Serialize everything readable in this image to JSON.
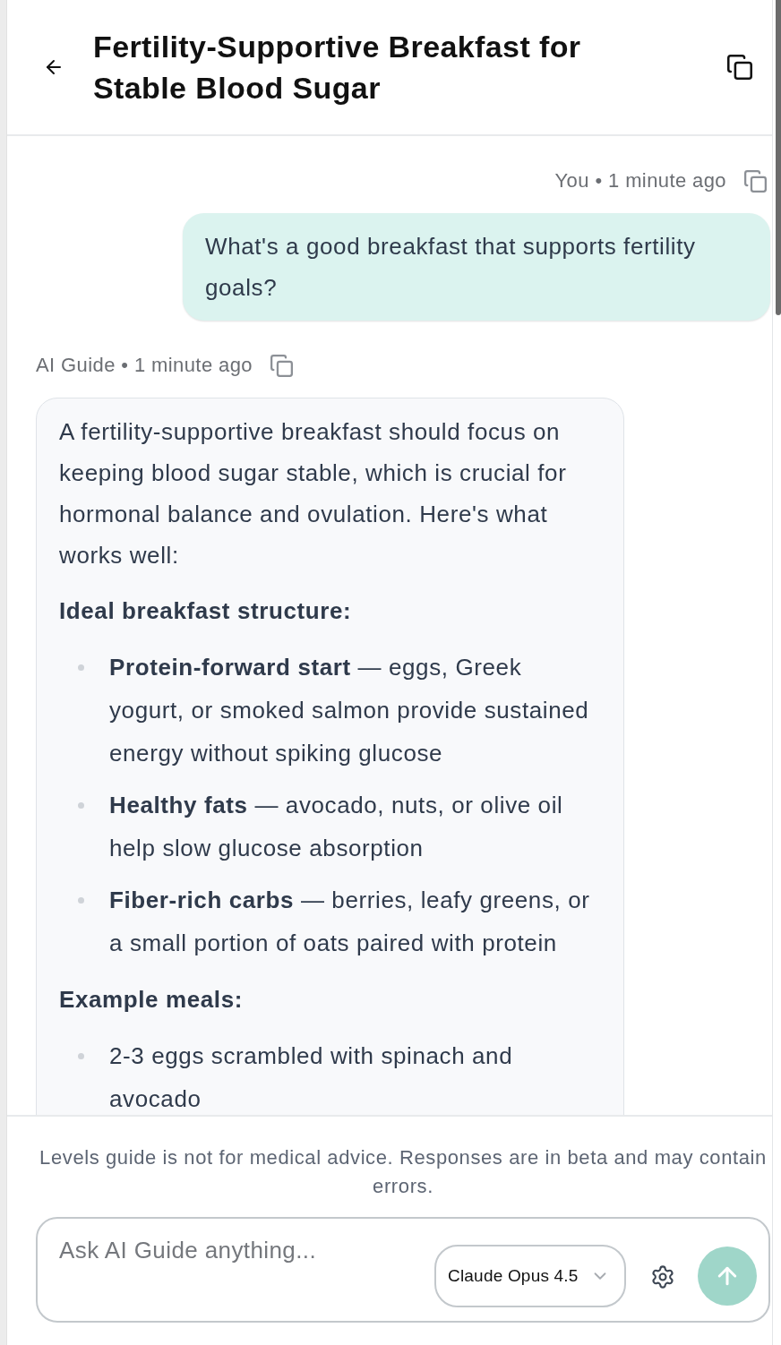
{
  "header": {
    "title": "Fertility-Supportive Breakfast for Stable Blood Sugar"
  },
  "messages": [
    {
      "kind": "user",
      "meta": "You • 1 minute ago",
      "blocks": [
        {
          "kind": "paragraph",
          "text": "What's a good breakfast that supports fertility goals?"
        }
      ]
    },
    {
      "kind": "assistant",
      "meta": "AI Guide • 1 minute ago",
      "blocks": [
        {
          "kind": "paragraph",
          "text": "A fertility-supportive breakfast should focus on keeping blood sugar stable, which is crucial for hormonal balance and ovulation. Here's what works well:"
        },
        {
          "kind": "heading",
          "text": "Ideal breakfast structure:"
        },
        {
          "kind": "list",
          "items": [
            "**Protein-forward start** — eggs, Greek yogurt, or smoked salmon provide sustained energy without spiking glucose",
            "**Healthy fats** — avocado, nuts, or olive oil help slow glucose absorption",
            "**Fiber-rich carbs** — berries, leafy greens, or a small portion of oats paired with protein"
          ]
        },
        {
          "kind": "heading",
          "text": "Example meals:"
        },
        {
          "kind": "list",
          "items": [
            "2-3 eggs scrambled with spinach and avocado"
          ]
        }
      ]
    }
  ],
  "footer": {
    "disclaimer": "Levels guide is not for medical advice. Responses are in beta and may contain errors.",
    "composer": {
      "placeholder": "Ask AI Guide anything...",
      "model": "Claude Opus 4.5"
    }
  }
}
